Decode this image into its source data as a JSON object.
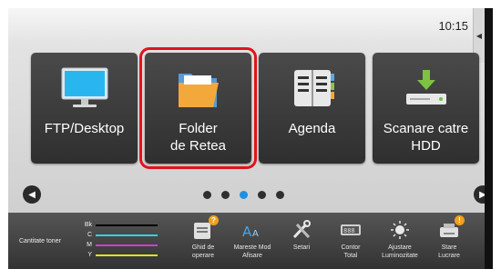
{
  "status": {
    "time": "10:15"
  },
  "tiles": [
    {
      "label": "FTP/Desktop",
      "icon": "monitor-icon"
    },
    {
      "label": "Folder\nde Retea",
      "icon": "folder-icon",
      "selected": true
    },
    {
      "label": "Agenda",
      "icon": "address-book-icon"
    },
    {
      "label": "Scanare catre\nHDD",
      "icon": "hdd-download-icon"
    }
  ],
  "pager": {
    "pages": 5,
    "active_index": 2
  },
  "toner": {
    "label": "Cantitate toner",
    "colors": [
      {
        "key": "Bk",
        "color": "#000000"
      },
      {
        "key": "C",
        "color": "#2fd3e6"
      },
      {
        "key": "M",
        "color": "#d23cd2"
      },
      {
        "key": "Y",
        "color": "#e6e020"
      }
    ]
  },
  "quick_actions": [
    {
      "label": "Ghid de\noperare",
      "icon": "operation-guide-icon",
      "badge": "?"
    },
    {
      "label": "Mareste Mod\nAfisare",
      "icon": "enlarge-display-icon"
    },
    {
      "label": "Setari",
      "icon": "settings-tools-icon"
    },
    {
      "label": "Contor\nTotal",
      "icon": "total-counter-icon"
    },
    {
      "label": "Ajustare\nLuminozitate",
      "icon": "brightness-icon"
    },
    {
      "label": "Stare\nLucrare",
      "icon": "job-status-icon",
      "badge": "!"
    }
  ],
  "colors": {
    "accent_blue": "#1e90e0",
    "selection_red": "#e1131c"
  }
}
